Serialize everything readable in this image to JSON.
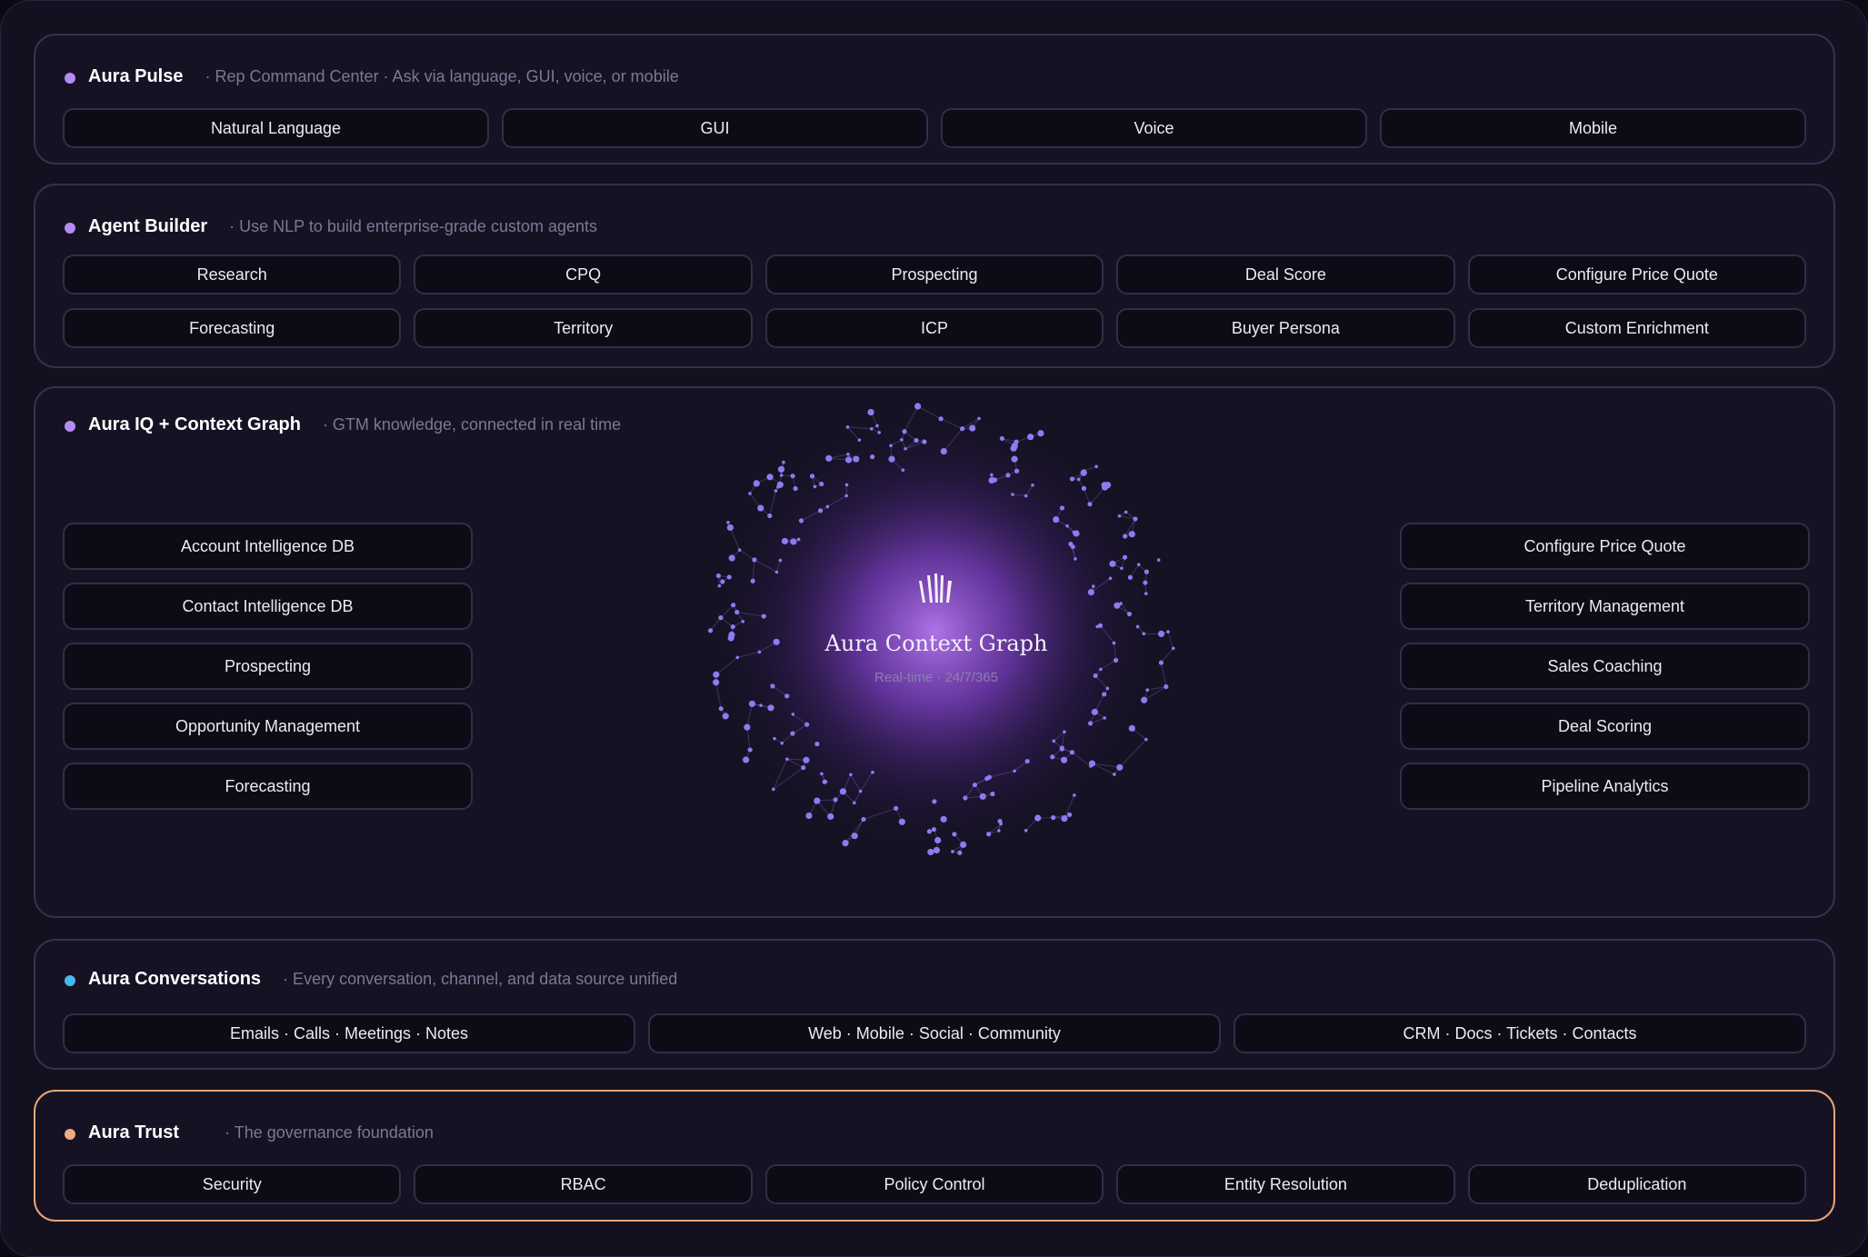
{
  "pulse": {
    "title": "Aura Pulse",
    "subtitle": "· Rep Command Center · Ask via language, GUI, voice, or mobile",
    "dot_color": "#b48cf0",
    "items": [
      "Natural Language",
      "GUI",
      "Voice",
      "Mobile"
    ]
  },
  "agent_builder": {
    "title": "Agent Builder",
    "subtitle": "· Use NLP to build enterprise-grade custom agents",
    "dot_color": "#b48cf0",
    "row1": [
      "Research",
      "CPQ",
      "Prospecting",
      "Deal Score",
      "Configure Price Quote"
    ],
    "row2": [
      "Forecasting",
      "Territory",
      "ICP",
      "Buyer Persona",
      "Custom Enrichment"
    ]
  },
  "aura_iq": {
    "title": "Aura IQ + Context Graph",
    "subtitle": "· GTM knowledge, connected in real time",
    "dot_color": "#b48cf0",
    "left": [
      "Account Intelligence DB",
      "Contact Intelligence DB",
      "Prospecting",
      "Opportunity Management",
      "Forecasting"
    ],
    "right": [
      "Configure Price Quote",
      "Territory Management",
      "Sales Coaching",
      "Deal Scoring",
      "Pipeline Analytics"
    ],
    "graph_title": "Aura Context Graph",
    "graph_subtitle": "Real-time · 24/7/365",
    "node_color": "#8b7cf0",
    "glow_color": "#9b5be0",
    "logo_icon": "aura-logo-icon"
  },
  "conversations": {
    "title": "Aura Conversations",
    "subtitle": "· Every conversation, channel, and data source unified",
    "dot_color": "#47b7f0",
    "items": [
      "Emails · Calls · Meetings · Notes",
      "Web · Mobile · Social · Community",
      "CRM · Docs · Tickets · Contacts"
    ]
  },
  "trust": {
    "title": "Aura Trust",
    "subtitle": "· The governance foundation",
    "dot_color": "#f0aa84",
    "border_color": "#e5a67c",
    "items": [
      "Security",
      "RBAC",
      "Policy Control",
      "Entity Resolution",
      "Deduplication"
    ]
  }
}
